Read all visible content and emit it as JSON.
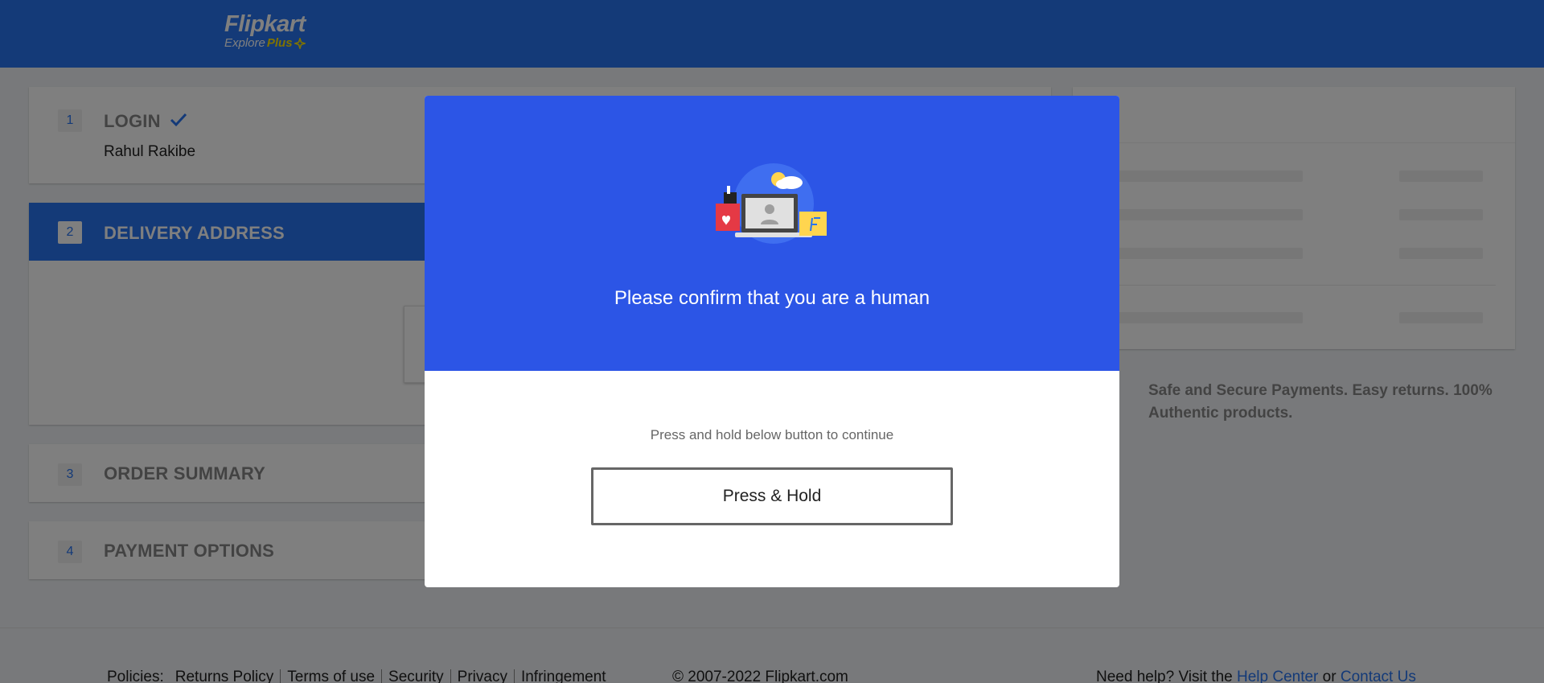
{
  "header": {
    "logo_text": "Flipkart",
    "logo_sub": "Explore",
    "logo_plus": "Plus",
    "brand_color": "#2874f0",
    "plus_color": "#ffe500"
  },
  "steps": {
    "login": {
      "number": "1",
      "title": "LOGIN",
      "user": "Rahul Rakibe",
      "done_icon": "check-icon"
    },
    "delivery": {
      "number": "2",
      "title": "DELIVERY ADDRESS"
    },
    "summary": {
      "number": "3",
      "title": "ORDER SUMMARY"
    },
    "payment": {
      "number": "4",
      "title": "PAYMENT OPTIONS"
    }
  },
  "sidebar": {
    "safe_text": "Safe and Secure Payments. Easy returns. 100% Authentic products.",
    "safe_icon": "shield-icon"
  },
  "footer": {
    "policies_label": "Policies:",
    "policies": [
      "Returns Policy",
      "Terms of use",
      "Security",
      "Privacy",
      "Infringement"
    ],
    "copyright": "© 2007-2022 Flipkart.com",
    "help_prefix": "Need help? Visit the",
    "help_center": "Help Center",
    "help_or": "or",
    "contact_us": "Contact Us"
  },
  "modal": {
    "title": "Please confirm that you are a human",
    "hint": "Press and hold below button to continue",
    "button_label": "Press & Hold",
    "top_color": "#2c55e6"
  }
}
